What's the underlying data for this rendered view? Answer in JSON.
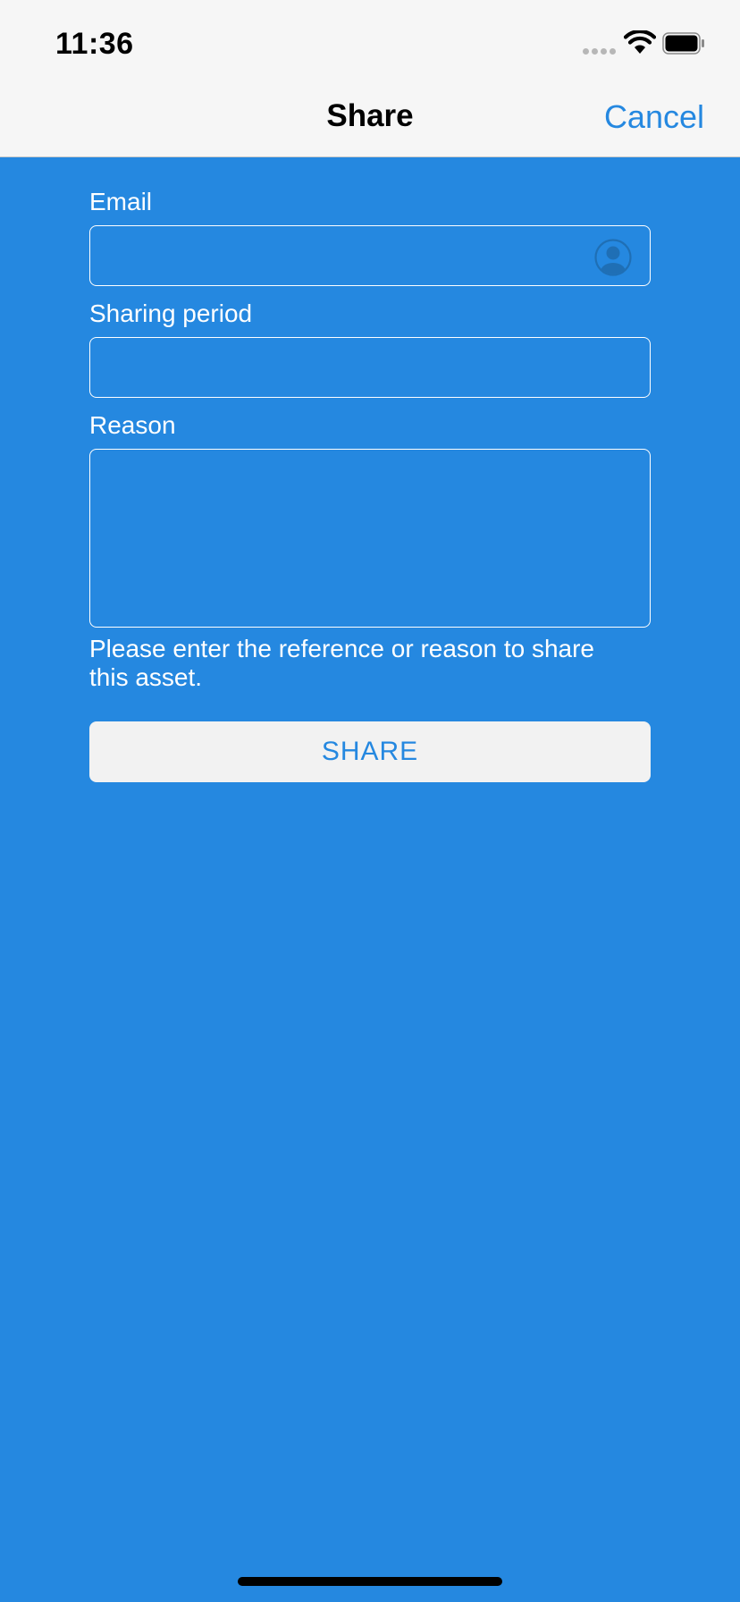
{
  "status_bar": {
    "time": "11:36",
    "signal_icon": "cellular-signal-icon",
    "wifi_icon": "wifi-icon",
    "battery_icon": "battery-icon"
  },
  "nav": {
    "title": "Share",
    "cancel_label": "Cancel"
  },
  "form": {
    "email_label": "Email",
    "email_value": "",
    "email_contact_icon": "person-circle-icon",
    "period_label": "Sharing period",
    "period_value": "",
    "reason_label": "Reason",
    "reason_value": "",
    "reason_hint": "Please enter the reference or reason to share this asset.",
    "share_button_label": "SHARE"
  },
  "colors": {
    "background": "#2588e0",
    "bar_background": "#f6f6f6",
    "accent": "#2588e0",
    "button_background": "#f2f2f2",
    "icon": "#1f6fb5"
  }
}
